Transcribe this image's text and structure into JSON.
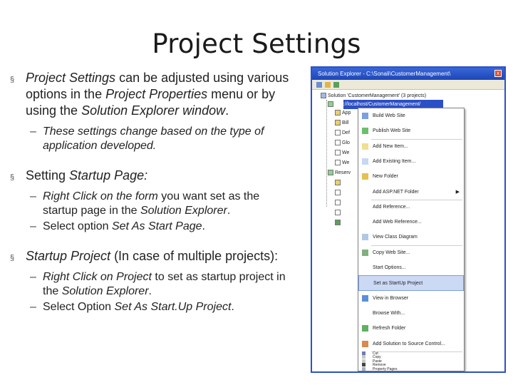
{
  "slide": {
    "title": "Project Settings",
    "bullet1": {
      "t1": "Project Settings",
      "t2": " can be adjusted using various options in the ",
      "t3": "Project Properties",
      "t4": " menu or by using the ",
      "t5": "Solution Explorer window",
      "t6": "."
    },
    "bullet1_sub": {
      "text": "These settings change based on the type of application developed."
    },
    "bullet2": {
      "t1": "Setting ",
      "t2": "Startup Page:"
    },
    "bullet2_sub1": {
      "t1": "Right Click on the form",
      "t2": " you want set as the startup page in the ",
      "t3": "Solution Explorer",
      "t4": "."
    },
    "bullet2_sub2": {
      "t1": "Select option ",
      "t2": "Set As Start Page",
      "t3": "."
    },
    "bullet3": {
      "t1": "Startup Project",
      "t2": " (In case of multiple projects):"
    },
    "bullet3_sub1": {
      "t1": "Right Click on Project",
      "t2": " to set as startup project in the ",
      "t3": "Solution Explorer",
      "t4": "."
    },
    "bullet3_sub2": {
      "t1": "Select Option ",
      "t2": "Set As Start.Up Project",
      "t3": "."
    },
    "marker": "§",
    "dash": "–"
  },
  "screenshot": {
    "window_title": "Solution Explorer - C:\\Sonali\\CustomerManagement\\",
    "tree": {
      "solution": "Solution 'CustomerManagement' (3 projects)",
      "project": "http://localhost/CustomerManagement/",
      "nodes": [
        "App",
        "Bill",
        "Def",
        "Glo",
        "We",
        "We",
        "Reserv"
      ],
      "close_icon": "x"
    },
    "menu": [
      {
        "label": "Build Web Site",
        "icon": "build-icon"
      },
      {
        "label": "Publish Web Site",
        "icon": "publish-icon"
      },
      {
        "label": "Add New Item...",
        "icon": "add-new-item-icon"
      },
      {
        "label": "Add Existing Item...",
        "icon": "add-existing-item-icon"
      },
      {
        "label": "New Folder",
        "icon": "folder-icon"
      },
      {
        "label": "Add ASP.NET Folder",
        "icon": "",
        "submenu": true
      },
      {
        "label": "Add Reference...",
        "icon": ""
      },
      {
        "label": "Add Web Reference...",
        "icon": ""
      },
      {
        "label": "View Class Diagram",
        "icon": "class-diagram-icon"
      },
      {
        "label": "Copy Web Site...",
        "icon": "copy-site-icon"
      },
      {
        "label": "Start Options...",
        "icon": ""
      },
      {
        "label": "Set as StartUp Project",
        "icon": "",
        "highlight": true
      },
      {
        "label": "View in Browser",
        "icon": "browser-icon"
      },
      {
        "label": "Browse With...",
        "icon": ""
      },
      {
        "label": "Refresh Folder",
        "icon": "refresh-icon"
      },
      {
        "label": "Add Solution to Source Control...",
        "icon": "source-control-icon"
      },
      {
        "label": "Cut",
        "icon": "cut-icon"
      },
      {
        "label": "Copy",
        "icon": "copy-icon"
      },
      {
        "label": "Paste",
        "icon": "paste-icon"
      },
      {
        "label": "Remove",
        "icon": "remove-icon"
      },
      {
        "label": "Property Pages",
        "icon": "property-pages-icon"
      }
    ],
    "submenu_arrow": "▶"
  },
  "colors": {
    "titlebar": "#1d46b8",
    "highlight": "#ccd9f5",
    "selection": "#2b4fc5"
  }
}
